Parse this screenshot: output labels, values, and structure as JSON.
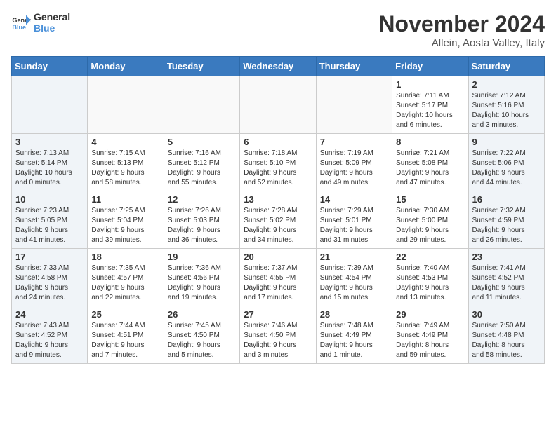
{
  "logo": {
    "line1": "General",
    "line2": "Blue"
  },
  "title": "November 2024",
  "location": "Allein, Aosta Valley, Italy",
  "weekdays": [
    "Sunday",
    "Monday",
    "Tuesday",
    "Wednesday",
    "Thursday",
    "Friday",
    "Saturday"
  ],
  "weeks": [
    [
      {
        "day": "",
        "info": ""
      },
      {
        "day": "",
        "info": ""
      },
      {
        "day": "",
        "info": ""
      },
      {
        "day": "",
        "info": ""
      },
      {
        "day": "",
        "info": ""
      },
      {
        "day": "1",
        "info": "Sunrise: 7:11 AM\nSunset: 5:17 PM\nDaylight: 10 hours\nand 6 minutes."
      },
      {
        "day": "2",
        "info": "Sunrise: 7:12 AM\nSunset: 5:16 PM\nDaylight: 10 hours\nand 3 minutes."
      }
    ],
    [
      {
        "day": "3",
        "info": "Sunrise: 7:13 AM\nSunset: 5:14 PM\nDaylight: 10 hours\nand 0 minutes."
      },
      {
        "day": "4",
        "info": "Sunrise: 7:15 AM\nSunset: 5:13 PM\nDaylight: 9 hours\nand 58 minutes."
      },
      {
        "day": "5",
        "info": "Sunrise: 7:16 AM\nSunset: 5:12 PM\nDaylight: 9 hours\nand 55 minutes."
      },
      {
        "day": "6",
        "info": "Sunrise: 7:18 AM\nSunset: 5:10 PM\nDaylight: 9 hours\nand 52 minutes."
      },
      {
        "day": "7",
        "info": "Sunrise: 7:19 AM\nSunset: 5:09 PM\nDaylight: 9 hours\nand 49 minutes."
      },
      {
        "day": "8",
        "info": "Sunrise: 7:21 AM\nSunset: 5:08 PM\nDaylight: 9 hours\nand 47 minutes."
      },
      {
        "day": "9",
        "info": "Sunrise: 7:22 AM\nSunset: 5:06 PM\nDaylight: 9 hours\nand 44 minutes."
      }
    ],
    [
      {
        "day": "10",
        "info": "Sunrise: 7:23 AM\nSunset: 5:05 PM\nDaylight: 9 hours\nand 41 minutes."
      },
      {
        "day": "11",
        "info": "Sunrise: 7:25 AM\nSunset: 5:04 PM\nDaylight: 9 hours\nand 39 minutes."
      },
      {
        "day": "12",
        "info": "Sunrise: 7:26 AM\nSunset: 5:03 PM\nDaylight: 9 hours\nand 36 minutes."
      },
      {
        "day": "13",
        "info": "Sunrise: 7:28 AM\nSunset: 5:02 PM\nDaylight: 9 hours\nand 34 minutes."
      },
      {
        "day": "14",
        "info": "Sunrise: 7:29 AM\nSunset: 5:01 PM\nDaylight: 9 hours\nand 31 minutes."
      },
      {
        "day": "15",
        "info": "Sunrise: 7:30 AM\nSunset: 5:00 PM\nDaylight: 9 hours\nand 29 minutes."
      },
      {
        "day": "16",
        "info": "Sunrise: 7:32 AM\nSunset: 4:59 PM\nDaylight: 9 hours\nand 26 minutes."
      }
    ],
    [
      {
        "day": "17",
        "info": "Sunrise: 7:33 AM\nSunset: 4:58 PM\nDaylight: 9 hours\nand 24 minutes."
      },
      {
        "day": "18",
        "info": "Sunrise: 7:35 AM\nSunset: 4:57 PM\nDaylight: 9 hours\nand 22 minutes."
      },
      {
        "day": "19",
        "info": "Sunrise: 7:36 AM\nSunset: 4:56 PM\nDaylight: 9 hours\nand 19 minutes."
      },
      {
        "day": "20",
        "info": "Sunrise: 7:37 AM\nSunset: 4:55 PM\nDaylight: 9 hours\nand 17 minutes."
      },
      {
        "day": "21",
        "info": "Sunrise: 7:39 AM\nSunset: 4:54 PM\nDaylight: 9 hours\nand 15 minutes."
      },
      {
        "day": "22",
        "info": "Sunrise: 7:40 AM\nSunset: 4:53 PM\nDaylight: 9 hours\nand 13 minutes."
      },
      {
        "day": "23",
        "info": "Sunrise: 7:41 AM\nSunset: 4:52 PM\nDaylight: 9 hours\nand 11 minutes."
      }
    ],
    [
      {
        "day": "24",
        "info": "Sunrise: 7:43 AM\nSunset: 4:52 PM\nDaylight: 9 hours\nand 9 minutes."
      },
      {
        "day": "25",
        "info": "Sunrise: 7:44 AM\nSunset: 4:51 PM\nDaylight: 9 hours\nand 7 minutes."
      },
      {
        "day": "26",
        "info": "Sunrise: 7:45 AM\nSunset: 4:50 PM\nDaylight: 9 hours\nand 5 minutes."
      },
      {
        "day": "27",
        "info": "Sunrise: 7:46 AM\nSunset: 4:50 PM\nDaylight: 9 hours\nand 3 minutes."
      },
      {
        "day": "28",
        "info": "Sunrise: 7:48 AM\nSunset: 4:49 PM\nDaylight: 9 hours\nand 1 minute."
      },
      {
        "day": "29",
        "info": "Sunrise: 7:49 AM\nSunset: 4:49 PM\nDaylight: 8 hours\nand 59 minutes."
      },
      {
        "day": "30",
        "info": "Sunrise: 7:50 AM\nSunset: 4:48 PM\nDaylight: 8 hours\nand 58 minutes."
      }
    ]
  ]
}
